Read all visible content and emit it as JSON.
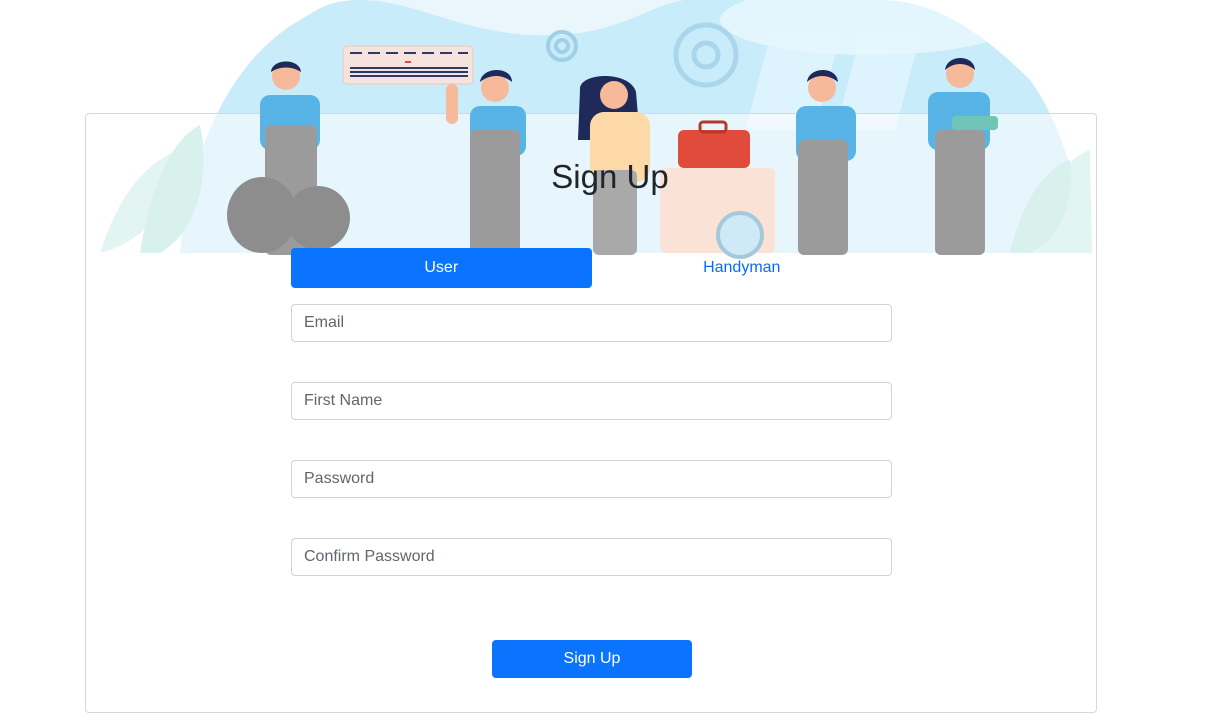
{
  "page": {
    "title": "Sign Up"
  },
  "tabs": [
    {
      "label": "User",
      "active": true
    },
    {
      "label": "Handyman",
      "active": false
    }
  ],
  "form": {
    "email_placeholder": "Email",
    "first_name_placeholder": "First Name",
    "password_placeholder": "Password",
    "confirm_password_placeholder": "Confirm Password",
    "submit_label": "Sign Up"
  },
  "colors": {
    "accent": "#0a74ff",
    "link": "#0a6cf0",
    "hero_sky": "#c9ecfa",
    "hero_plant": "#bfe8e2"
  },
  "hero": {
    "illustration": "handymen-group-illustration"
  }
}
